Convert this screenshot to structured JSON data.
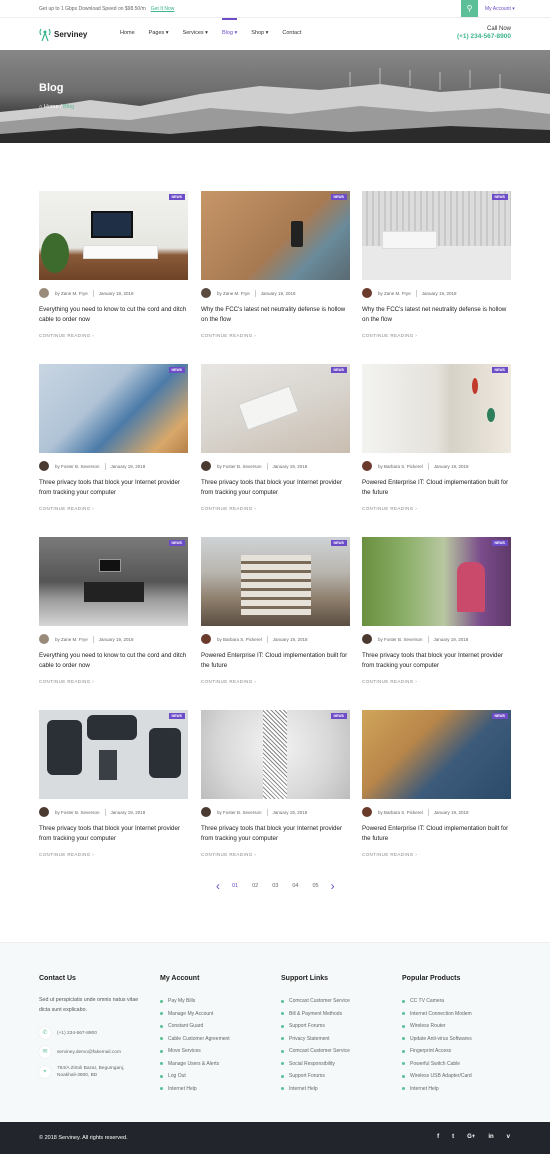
{
  "topbar": {
    "promo": "Get up to 1 Gbps Download Speed on $98.50/m",
    "promo_link": "Get It Now",
    "account": "My Account ▾"
  },
  "brand": {
    "name": "Serviney"
  },
  "menu": [
    {
      "label": "Home"
    },
    {
      "label": "Pages ▾"
    },
    {
      "label": "Services ▾"
    },
    {
      "label": "Blog ▾"
    },
    {
      "label": "Shop ▾"
    },
    {
      "label": "Contact"
    }
  ],
  "call": {
    "label": "Call Now",
    "number": "(+1) 234-567-8900"
  },
  "hero": {
    "title": "Blog",
    "crumb_home": "Home",
    "crumb_sep": "/",
    "crumb_current": "Blog"
  },
  "posts": [
    {
      "tag": "NEWS",
      "author": "by Zane M. Frye",
      "date": "January 19, 2018",
      "title": "Everything you need to know to cut the cord and ditch cable to order now",
      "more": "CONTINUE READING ›"
    },
    {
      "tag": "NEWS",
      "author": "by Zane M. Frye",
      "date": "January 19, 2018",
      "title": "Why the FCC's latest net neutrality defense is hollow on the flow",
      "more": "CONTINUE READING ›"
    },
    {
      "tag": "NEWS",
      "author": "by Zane M. Frye",
      "date": "January 19, 2018",
      "title": "Why the FCC's latest net neutrality defense is hollow on the flow",
      "more": "CONTINUE READING ›"
    },
    {
      "tag": "NEWS",
      "author": "by Foster B. Severson",
      "date": "January 19, 2018",
      "title": "Three privacy tools that block your Internet provider from tracking your computer",
      "more": "CONTINUE READING ›"
    },
    {
      "tag": "NEWS",
      "author": "by Foster B. Severson",
      "date": "January 19, 2018",
      "title": "Three privacy tools that block your Internet provider from tracking your computer",
      "more": "CONTINUE READING ›"
    },
    {
      "tag": "NEWS",
      "author": "by Barbara S. Pickerel",
      "date": "January 19, 2018",
      "title": "Powered Enterprise IT: Cloud implementation built for the future",
      "more": "CONTINUE READING ›"
    },
    {
      "tag": "NEWS",
      "author": "by Zane M. Frye",
      "date": "January 19, 2018",
      "title": "Everything you need to know to cut the cord and ditch cable to order now",
      "more": "CONTINUE READING ›"
    },
    {
      "tag": "NEWS",
      "author": "by Barbara S. Pickerel",
      "date": "January 19, 2018",
      "title": "Powered Enterprise IT: Cloud implementation built for the future",
      "more": "CONTINUE READING ›"
    },
    {
      "tag": "NEWS",
      "author": "by Foster B. Severson",
      "date": "January 19, 2018",
      "title": "Three privacy tools that block your Internet provider from tracking your computer",
      "more": "CONTINUE READING ›"
    },
    {
      "tag": "NEWS",
      "author": "by Foster B. Severson",
      "date": "January 19, 2018",
      "title": "Three privacy tools that block your Internet provider from tracking your computer",
      "more": "CONTINUE READING ›"
    },
    {
      "tag": "NEWS",
      "author": "by Foster B. Severson",
      "date": "January 19, 2018",
      "title": "Three privacy tools that block your Internet provider from tracking your computer",
      "more": "CONTINUE READING ›"
    },
    {
      "tag": "NEWS",
      "author": "by Barbara S. Pickerel",
      "date": "January 19, 2018",
      "title": "Powered Enterprise IT: Cloud implementation built for the future",
      "more": "CONTINUE READING ›"
    }
  ],
  "pagination": {
    "prev": "‹",
    "pages": [
      "01",
      "02",
      "03",
      "04",
      "05"
    ],
    "next": "›"
  },
  "footer": {
    "contact": {
      "title": "Contact Us",
      "desc": "Sed ut perspiciatis unde omnis natus vitae dicta sunt explicabo.",
      "phone": "(+1) 234-567-8900",
      "email": "serviney.demo@fakemail.com",
      "address": "784/A Zirtoli Bazar, Begumganj, Noakhali-3800, BD"
    },
    "account": {
      "title": "My Account",
      "items": [
        "Pay My Bills",
        "Manage My Account",
        "Constant Guard",
        "Cable Customer Agreement",
        "Move Services",
        "Manage Users & Alerts",
        "Log Out",
        "Internet Help"
      ]
    },
    "support": {
      "title": "Support Links",
      "items": [
        "Comcast Customer Service",
        "Bill & Payment Methods",
        "Support Forums",
        "Privacy Statement",
        "Comcast Customer Service",
        "Social Responsibility",
        "Support Forums",
        "Internet Help"
      ]
    },
    "products": {
      "title": "Popular Products",
      "items": [
        "CC TV Camera",
        "Internet Connection Modem",
        "Wireless Router",
        "Update Anti-virus Softwares",
        "Fingerprint Access",
        "Powerful Switch Cable",
        "Wireless USB Adapter/Card",
        "Internet Help"
      ]
    },
    "copyright": "© 2018 Serviney. All rights reserved.",
    "social": [
      "f",
      "t",
      "G+",
      "in",
      "v"
    ]
  },
  "colors": {
    "accent": "#6d4cc7",
    "green": "#5cbf97",
    "dark": "#22252b"
  }
}
